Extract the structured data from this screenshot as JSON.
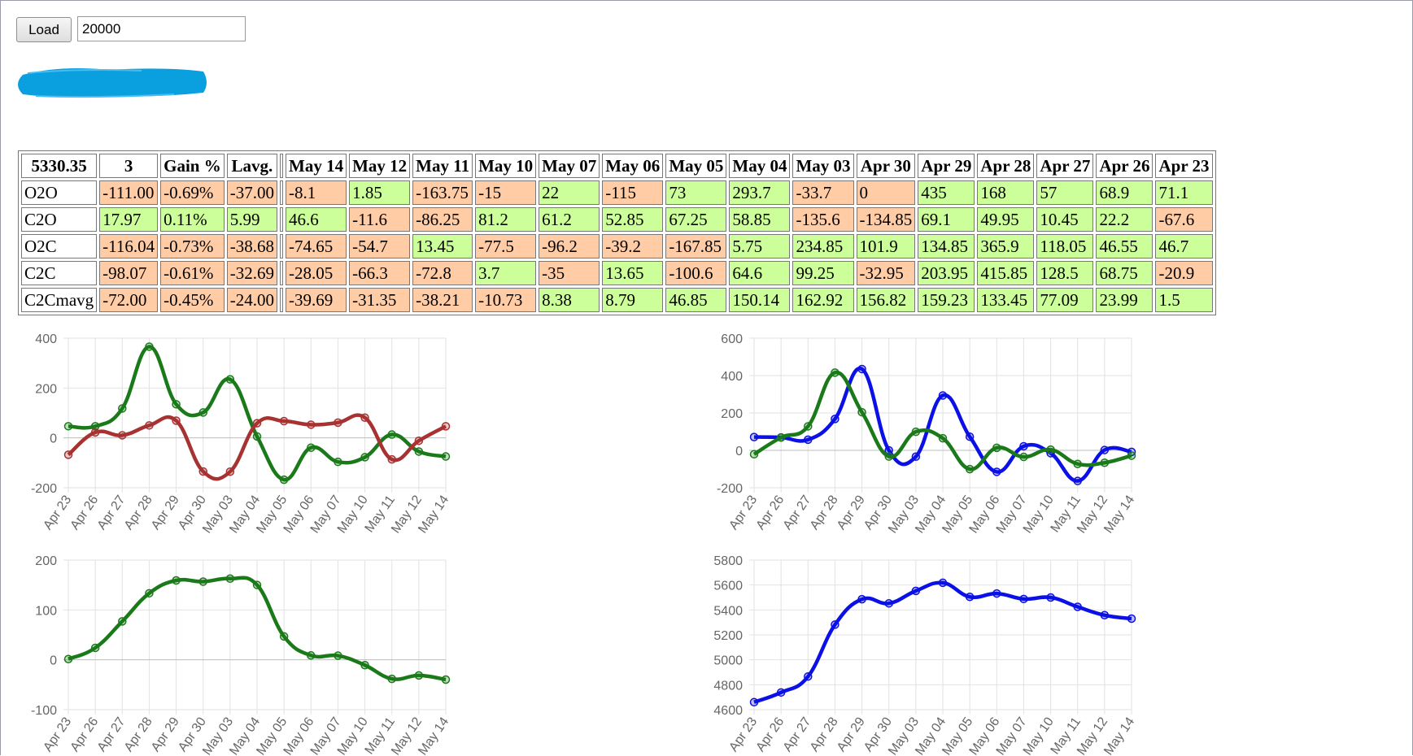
{
  "controls": {
    "load_label": "Load",
    "amount_value": "20000"
  },
  "colors": {
    "positive": "#ccff99",
    "negative": "#ffcca6",
    "green": "#1a7a1a",
    "red": "#a83232",
    "blue": "#0a10e6",
    "redaction": "#0aa0e0"
  },
  "table": {
    "headers": [
      "5330.35",
      "3",
      "Gain %",
      "Lavg.",
      "",
      "May 14",
      "May 12",
      "May 11",
      "May 10",
      "May 07",
      "May 06",
      "May 05",
      "May 04",
      "May 03",
      "Apr 30",
      "Apr 29",
      "Apr 28",
      "Apr 27",
      "Apr 26",
      "Apr 23"
    ],
    "rows": [
      {
        "label": "O2O",
        "summary": [
          "-111.00",
          "-0.69%",
          "-37.00"
        ],
        "values": [
          "-8.1",
          "1.85",
          "-163.75",
          "-15",
          "22",
          "-115",
          "73",
          "293.7",
          "-33.7",
          "0",
          "435",
          "168",
          "57",
          "68.9",
          "71.1"
        ]
      },
      {
        "label": "C2O",
        "summary": [
          "17.97",
          "0.11%",
          "5.99"
        ],
        "values": [
          "46.6",
          "-11.6",
          "-86.25",
          "81.2",
          "61.2",
          "52.85",
          "67.25",
          "58.85",
          "-135.6",
          "-134.85",
          "69.1",
          "49.95",
          "10.45",
          "22.2",
          "-67.6"
        ]
      },
      {
        "label": "O2C",
        "summary": [
          "-116.04",
          "-0.73%",
          "-38.68"
        ],
        "values": [
          "-74.65",
          "-54.7",
          "13.45",
          "-77.5",
          "-96.2",
          "-39.2",
          "-167.85",
          "5.75",
          "234.85",
          "101.9",
          "134.85",
          "365.9",
          "118.05",
          "46.55",
          "46.7"
        ]
      },
      {
        "label": "C2C",
        "summary": [
          "-98.07",
          "-0.61%",
          "-32.69"
        ],
        "values": [
          "-28.05",
          "-66.3",
          "-72.8",
          "3.7",
          "-35",
          "13.65",
          "-100.6",
          "64.6",
          "99.25",
          "-32.95",
          "203.95",
          "415.85",
          "128.5",
          "68.75",
          "-20.9"
        ]
      },
      {
        "label": "C2Cmavg",
        "summary": [
          "-72.00",
          "-0.45%",
          "-24.00"
        ],
        "values": [
          "-39.69",
          "-31.35",
          "-38.21",
          "-10.73",
          "8.38",
          "8.79",
          "46.85",
          "150.14",
          "162.92",
          "156.82",
          "159.23",
          "133.45",
          "77.09",
          "23.99",
          "1.5"
        ]
      }
    ]
  },
  "chart_data": [
    {
      "type": "line",
      "x": [
        "Apr 23",
        "Apr 26",
        "Apr 27",
        "Apr 28",
        "Apr 29",
        "Apr 30",
        "May 03",
        "May 04",
        "May 05",
        "May 06",
        "May 07",
        "May 10",
        "May 11",
        "May 12",
        "May 14"
      ],
      "ylim": [
        -200,
        400
      ],
      "yticks": [
        -200,
        0,
        200,
        400
      ],
      "grid": true,
      "series": [
        {
          "color": "#1a7a1a",
          "values": [
            46.7,
            46.55,
            118.05,
            365.9,
            134.85,
            101.9,
            234.85,
            5.75,
            -167.85,
            -39.2,
            -96.2,
            -77.5,
            13.45,
            -54.7,
            -74.65
          ]
        },
        {
          "color": "#a83232",
          "values": [
            -67.6,
            22.2,
            10.45,
            49.95,
            69.1,
            -134.85,
            -135.6,
            58.85,
            67.25,
            52.85,
            61.2,
            81.2,
            -86.25,
            -11.6,
            46.6
          ]
        }
      ]
    },
    {
      "type": "line",
      "x": [
        "Apr 23",
        "Apr 26",
        "Apr 27",
        "Apr 28",
        "Apr 29",
        "Apr 30",
        "May 03",
        "May 04",
        "May 05",
        "May 06",
        "May 07",
        "May 10",
        "May 11",
        "May 12",
        "May 14"
      ],
      "ylim": [
        -200,
        600
      ],
      "yticks": [
        -200,
        0,
        200,
        400,
        600
      ],
      "grid": true,
      "series": [
        {
          "color": "#0a10e6",
          "values": [
            71.1,
            68.9,
            57,
            168,
            435,
            0,
            -33.7,
            293.7,
            73,
            -115,
            22,
            -15,
            -163.75,
            1.85,
            -8.1
          ]
        },
        {
          "color": "#1a7a1a",
          "values": [
            -20.9,
            68.75,
            128.5,
            415.85,
            203.95,
            -32.95,
            99.25,
            64.6,
            -100.6,
            13.65,
            -35,
            3.7,
            -72.8,
            -66.3,
            -28.05
          ]
        }
      ]
    },
    {
      "type": "line",
      "x": [
        "Apr 23",
        "Apr 26",
        "Apr 27",
        "Apr 28",
        "Apr 29",
        "Apr 30",
        "May 03",
        "May 04",
        "May 05",
        "May 06",
        "May 07",
        "May 10",
        "May 11",
        "May 12",
        "May 14"
      ],
      "ylim": [
        -100,
        200
      ],
      "yticks": [
        -100,
        0,
        100,
        200
      ],
      "grid": true,
      "series": [
        {
          "color": "#1a7a1a",
          "values": [
            1.5,
            23.99,
            77.09,
            133.45,
            159.23,
            156.82,
            162.92,
            150.14,
            46.85,
            8.79,
            8.38,
            -10.73,
            -38.21,
            -31.35,
            -39.69
          ]
        }
      ]
    },
    {
      "type": "line",
      "x": [
        "Apr 23",
        "Apr 26",
        "Apr 27",
        "Apr 28",
        "Apr 29",
        "Apr 30",
        "May 03",
        "May 04",
        "May 05",
        "May 06",
        "May 07",
        "May 10",
        "May 11",
        "May 12",
        "May 14"
      ],
      "ylim": [
        4600,
        5800
      ],
      "yticks": [
        4600,
        4800,
        5000,
        5200,
        5400,
        5600,
        5800
      ],
      "grid": true,
      "series": [
        {
          "color": "#0a10e6",
          "values": [
            4660,
            4738,
            4866,
            5282,
            5486,
            5453,
            5553,
            5618,
            5505,
            5532,
            5488,
            5500,
            5425,
            5358,
            5330.35
          ]
        }
      ]
    }
  ]
}
